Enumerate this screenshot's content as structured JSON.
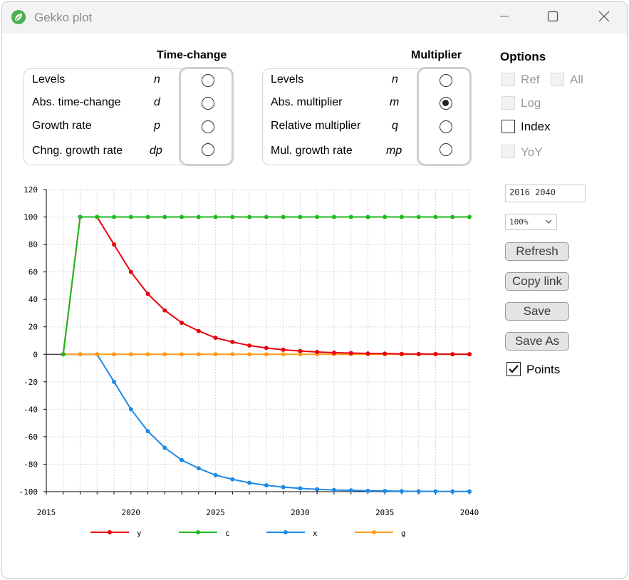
{
  "window": {
    "title": "Gekko plot"
  },
  "time_change": {
    "title": "Time-change",
    "rows": [
      {
        "label": "Levels",
        "code": "n",
        "selected": false
      },
      {
        "label": "Abs. time-change",
        "code": "d",
        "selected": false
      },
      {
        "label": "Growth rate",
        "code": "p",
        "selected": false
      },
      {
        "label": "Chng. growth rate",
        "code": "dp",
        "selected": false
      }
    ]
  },
  "multiplier": {
    "title": "Multiplier",
    "rows": [
      {
        "label": "Levels",
        "code": "n",
        "selected": false
      },
      {
        "label": "Abs. multiplier",
        "code": "m",
        "selected": true
      },
      {
        "label": "Relative multiplier",
        "code": "q",
        "selected": false
      },
      {
        "label": "Mul. growth rate",
        "code": "mp",
        "selected": false
      }
    ]
  },
  "options": {
    "title": "Options",
    "ref": "Ref",
    "all": "All",
    "log": "Log",
    "index": "Index",
    "yoy": "YoY"
  },
  "controls": {
    "range_value": "2016 2040",
    "zoom_value": "100%",
    "refresh_label": "Refresh",
    "copy_link_label": "Copy link",
    "save_label": "Save",
    "save_as_label": "Save As",
    "points_label": "Points",
    "points_checked": true
  },
  "icons": {
    "app": "gekko-leaf-icon",
    "minimize": "minimize-icon",
    "maximize": "maximize-icon",
    "close": "close-icon",
    "dropdown": "chevron-down-icon",
    "check": "checkmark-icon"
  },
  "chart_data": {
    "type": "line",
    "title": "",
    "xlabel": "",
    "ylabel": "",
    "xlim": [
      2015,
      2040
    ],
    "ylim": [
      -100,
      120
    ],
    "x_ticks": [
      2015,
      2020,
      2025,
      2030,
      2035,
      2040
    ],
    "y_ticks": [
      120,
      100,
      80,
      60,
      40,
      20,
      0,
      -20,
      -40,
      -60,
      -80,
      -100
    ],
    "grid": true,
    "legend_position": "bottom",
    "x": [
      2016,
      2017,
      2018,
      2019,
      2020,
      2021,
      2022,
      2023,
      2024,
      2025,
      2026,
      2027,
      2028,
      2029,
      2030,
      2031,
      2032,
      2033,
      2034,
      2035,
      2036,
      2037,
      2038,
      2039,
      2040
    ],
    "series": [
      {
        "name": "y",
        "color": "#e8000b",
        "values": [
          0,
          100,
          100,
          80,
          60,
          44,
          32,
          23,
          17,
          12,
          9,
          6.4,
          4.6,
          3.3,
          2.4,
          1.7,
          1.2,
          0.9,
          0.6,
          0.5,
          0.3,
          0.2,
          0.2,
          0.1,
          0.1
        ]
      },
      {
        "name": "c",
        "color": "#1eb81e",
        "values": [
          0,
          100,
          100,
          100,
          100,
          100,
          100,
          100,
          100,
          100,
          100,
          100,
          100,
          100,
          100,
          100,
          100,
          100,
          100,
          100,
          100,
          100,
          100,
          100,
          100
        ]
      },
      {
        "name": "x",
        "color": "#1e88e5",
        "values": [
          0,
          0,
          0,
          -20,
          -40,
          -56,
          -68,
          -77,
          -83,
          -88,
          -91,
          -93.6,
          -95.4,
          -96.7,
          -97.6,
          -98.3,
          -98.8,
          -99.1,
          -99.4,
          -99.5,
          -99.7,
          -99.8,
          -99.8,
          -99.9,
          -99.9
        ]
      },
      {
        "name": "g",
        "color": "#ff9f1a",
        "values": [
          0,
          0,
          0,
          0,
          0,
          0,
          0,
          0,
          0,
          0,
          0,
          0,
          0,
          0,
          0,
          0,
          0,
          0,
          0,
          0,
          0,
          0,
          0,
          0,
          0
        ]
      }
    ]
  }
}
